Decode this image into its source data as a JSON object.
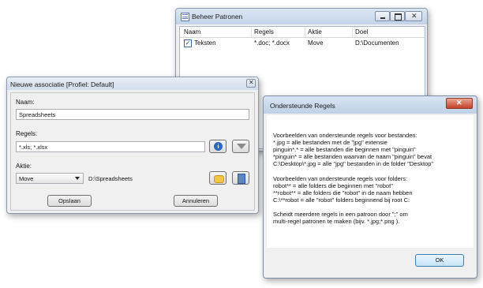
{
  "beheer": {
    "title": "Beheer Patronen",
    "columns": [
      "Naam",
      "Regels",
      "Aktie",
      "Doel"
    ],
    "row": {
      "naam": "Teksten",
      "regels": "*.doc; *.docx",
      "aktie": "Move",
      "doel": "D:\\Documenten",
      "checked": true
    }
  },
  "nieuwe": {
    "title": "Nieuwe associatie [Profiel: Default]",
    "naam_label": "Naam:",
    "naam_value": "Spreadsheets",
    "regels_label": "Regels:",
    "regels_value": "*.xls; *.xlsx",
    "aktie_label": "Aktie:",
    "aktie_value": "Move",
    "target_value": "D:\\Spreadsheets",
    "save_label": "Opslaan",
    "cancel_label": "Annuleren"
  },
  "ondersteunde": {
    "title": "Ondersteunde Regels",
    "lines": [
      "Voorbeelden van ondersteunde regels voor bestanden:",
      "*.jpg = alle bestanden met de \"jpg\" extensie",
      "pinguin*.* = alle bestanden die beginnen met \"pinguin\"",
      "*pinguin* = alle bestanden waarvan de naam \"pinguin\" bevat",
      "C:\\Desktop\\*.jpg = alle \"jpg\" bestanden in de folder \"Desktop\"",
      "",
      "Voorbeelden van ondersteunde regels voor folders:",
      "robot** = alle folders die beginnen met \"robot\"",
      "**robot** = alle folders die \"robot\" in de naam hebben",
      "C:\\**robot = alle \"robot\" folders beginnend bij root C:",
      "",
      "Scheidt meerdere regels in een patroon door \";\" om",
      "multi-regel patronen te maken (bijv. *.jpg;*.png )."
    ],
    "ok_label": "OK"
  }
}
